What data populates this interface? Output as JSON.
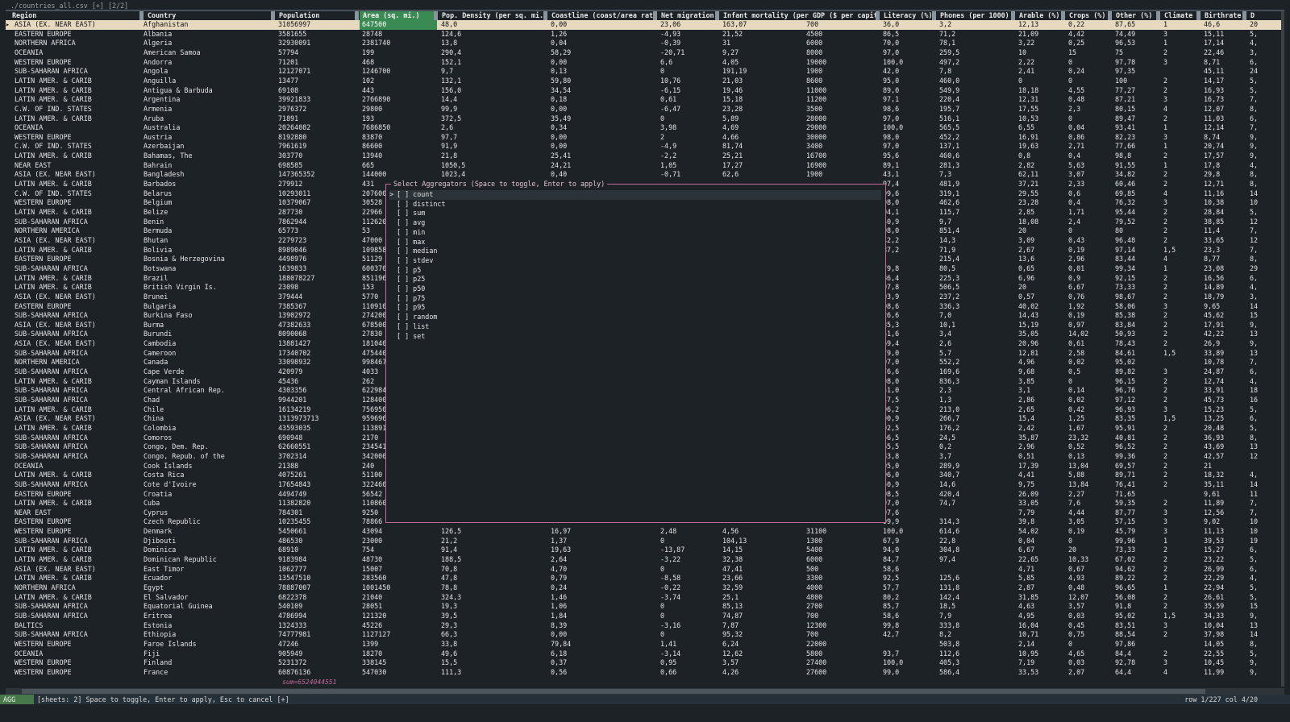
{
  "window": {
    "title": "./countries_all.csv [+] [2/2]"
  },
  "columns": [
    {
      "label": "Region"
    },
    {
      "label": "Country"
    },
    {
      "label": "Population"
    },
    {
      "label": "Area (sq. mi.)",
      "active": true
    },
    {
      "label": "Pop. Density (per sq. mi.)"
    },
    {
      "label": "Coastline (coast/area ratio)"
    },
    {
      "label": "Net migration"
    },
    {
      "label": "Infant mortality (per GDP ($ per capita)"
    },
    {
      "label": "Literacy (%)"
    },
    {
      "label": "Phones (per 1000)"
    },
    {
      "label": "Arable (%)"
    },
    {
      "label": "Crops (%)"
    },
    {
      "label": "Other (%)"
    },
    {
      "label": "Climate"
    },
    {
      "label": "Birthrate"
    },
    {
      "label": "D"
    }
  ],
  "rows": [
    [
      "ASIA (EX. NEAR EAST)",
      "Afghanistan",
      "31056997",
      "647500",
      "48,0",
      "0,00",
      "23,06",
      "163,07",
      "700",
      "36,0",
      "3,2",
      "12,13",
      "0,22",
      "87,65",
      "1",
      "46,6",
      "20"
    ],
    [
      "EASTERN EUROPE",
      "Albania",
      "3581655",
      "28748",
      "124,6",
      "1,26",
      "-4,93",
      "21,52",
      "4500",
      "86,5",
      "71,2",
      "21,09",
      "4,42",
      "74,49",
      "3",
      "15,11",
      "5,"
    ],
    [
      "NORTHERN AFRICA",
      "Algeria",
      "32930091",
      "2381740",
      "13,8",
      "0,04",
      "-0,39",
      "31",
      "6000",
      "70,0",
      "78,1",
      "3,22",
      "0,25",
      "96,53",
      "1",
      "17,14",
      "4,"
    ],
    [
      "OCEANIA",
      "American Samoa",
      "57794",
      "199",
      "290,4",
      "58,29",
      "-20,71",
      "9,27",
      "8000",
      "97,0",
      "259,5",
      "10",
      "15",
      "75",
      "2",
      "22,46",
      "3,"
    ],
    [
      "WESTERN EUROPE",
      "Andorra",
      "71201",
      "468",
      "152,1",
      "0,00",
      "6,6",
      "4,05",
      "19000",
      "100,0",
      "497,2",
      "2,22",
      "0",
      "97,78",
      "3",
      "8,71",
      "6,"
    ],
    [
      "SUB-SAHARAN AFRICA",
      "Angola",
      "12127071",
      "1246700",
      "9,7",
      "0,13",
      "0",
      "191,19",
      "1900",
      "42,0",
      "7,8",
      "2,41",
      "0,24",
      "97,35",
      "",
      "45,11",
      "24"
    ],
    [
      "LATIN AMER. & CARIB",
      "Anguilla",
      "13477",
      "102",
      "132,1",
      "59,80",
      "10,76",
      "21,03",
      "8600",
      "95,0",
      "460,0",
      "0",
      "0",
      "100",
      "2",
      "14,17",
      "5,"
    ],
    [
      "LATIN AMER. & CARIB",
      "Antigua & Barbuda",
      "69108",
      "443",
      "156,0",
      "34,54",
      "-6,15",
      "19,46",
      "11000",
      "89,0",
      "549,9",
      "18,18",
      "4,55",
      "77,27",
      "2",
      "16,93",
      "5,"
    ],
    [
      "LATIN AMER. & CARIB",
      "Argentina",
      "39921833",
      "2766890",
      "14,4",
      "0,18",
      "0,61",
      "15,18",
      "11200",
      "97,1",
      "220,4",
      "12,31",
      "0,48",
      "87,21",
      "3",
      "16,73",
      "7,"
    ],
    [
      "C.W. OF IND. STATES",
      "Armenia",
      "2976372",
      "29800",
      "99,9",
      "0,00",
      "-6,47",
      "23,28",
      "3500",
      "98,6",
      "195,7",
      "17,55",
      "2,3",
      "80,15",
      "4",
      "12,07",
      "8,"
    ],
    [
      "LATIN AMER. & CARIB",
      "Aruba",
      "71891",
      "193",
      "372,5",
      "35,49",
      "0",
      "5,89",
      "28000",
      "97,0",
      "516,1",
      "10,53",
      "0",
      "89,47",
      "2",
      "11,03",
      "6,"
    ],
    [
      "OCEANIA",
      "Australia",
      "20264082",
      "7686850",
      "2,6",
      "0,34",
      "3,98",
      "4,69",
      "29000",
      "100,0",
      "565,5",
      "6,55",
      "0,04",
      "93,41",
      "1",
      "12,14",
      "7,"
    ],
    [
      "WESTERN EUROPE",
      "Austria",
      "8192880",
      "83870",
      "97,7",
      "0,00",
      "2",
      "4,66",
      "30000",
      "98,0",
      "452,2",
      "16,91",
      "0,86",
      "82,23",
      "3",
      "8,74",
      "9,"
    ],
    [
      "C.W. OF IND. STATES",
      "Azerbaijan",
      "7961619",
      "86600",
      "91,9",
      "0,00",
      "-4,9",
      "81,74",
      "3400",
      "97,0",
      "137,1",
      "19,63",
      "2,71",
      "77,66",
      "1",
      "20,74",
      "9,"
    ],
    [
      "LATIN AMER. & CARIB",
      "Bahamas, The",
      "303770",
      "13940",
      "21,8",
      "25,41",
      "-2,2",
      "25,21",
      "16700",
      "95,6",
      "460,6",
      "0,8",
      "0,4",
      "98,8",
      "2",
      "17,57",
      "9,"
    ],
    [
      "NEAR EAST",
      "Bahrain",
      "698585",
      "665",
      "1050,5",
      "24,21",
      "1,05",
      "17,27",
      "16900",
      "89,1",
      "281,3",
      "2,82",
      "5,63",
      "91,55",
      "1",
      "17,8",
      "4,"
    ],
    [
      "ASIA (EX. NEAR EAST)",
      "Bangladesh",
      "147365352",
      "144000",
      "1023,4",
      "0,40",
      "-0,71",
      "62,6",
      "1900",
      "43,1",
      "7,3",
      "62,11",
      "3,07",
      "34,82",
      "2",
      "29,8",
      "8,"
    ],
    [
      "LATIN AMER. & CARIB",
      "Barbados",
      "279912",
      "431",
      "",
      "",
      "",
      "",
      "",
      "97,4",
      "481,9",
      "37,21",
      "2,33",
      "60,46",
      "2",
      "12,71",
      "8,"
    ],
    [
      "C.W. OF IND. STATES",
      "Belarus",
      "10293011",
      "207600",
      "",
      "",
      "",
      "",
      "",
      "99,6",
      "319,1",
      "29,55",
      "0,6",
      "69,85",
      "4",
      "11,16",
      "14"
    ],
    [
      "WESTERN EUROPE",
      "Belgium",
      "10379067",
      "30528",
      "",
      "",
      "",
      "",
      "",
      "98,0",
      "462,6",
      "23,28",
      "0,4",
      "76,32",
      "3",
      "10,38",
      "10"
    ],
    [
      "LATIN AMER. & CARIB",
      "Belize",
      "287730",
      "22966",
      "",
      "",
      "",
      "",
      "",
      "94,1",
      "115,7",
      "2,85",
      "1,71",
      "95,44",
      "2",
      "28,84",
      "5,"
    ],
    [
      "SUB-SAHARAN AFRICA",
      "Benin",
      "7862944",
      "112620",
      "",
      "",
      "",
      "",
      "",
      "40,9",
      "9,7",
      "18,08",
      "2,4",
      "79,52",
      "2",
      "38,85",
      "12"
    ],
    [
      "NORTHERN AMERICA",
      "Bermuda",
      "65773",
      "53",
      "",
      "",
      "",
      "",
      "",
      "98,0",
      "851,4",
      "20",
      "0",
      "80",
      "2",
      "11,4",
      "7,"
    ],
    [
      "ASIA (EX. NEAR EAST)",
      "Bhutan",
      "2279723",
      "47000",
      "",
      "",
      "",
      "",
      "",
      "42,2",
      "14,3",
      "3,09",
      "0,43",
      "96,48",
      "2",
      "33,65",
      "12"
    ],
    [
      "LATIN AMER. & CARIB",
      "Bolivia",
      "8989046",
      "109858",
      "",
      "",
      "",
      "",
      "",
      "87,2",
      "71,9",
      "2,67",
      "0,19",
      "97,14",
      "1,5",
      "23,3",
      "7,"
    ],
    [
      "EASTERN EUROPE",
      "Bosnia & Herzegovina",
      "4498976",
      "51129",
      "",
      "",
      "",
      "",
      "",
      "",
      "215,4",
      "13,6",
      "2,96",
      "83,44",
      "4",
      "8,77",
      "8,"
    ],
    [
      "SUB-SAHARAN AFRICA",
      "Botswana",
      "1639833",
      "600370",
      "",
      "",
      "",
      "",
      "",
      "79,8",
      "80,5",
      "0,65",
      "0,01",
      "99,34",
      "1",
      "23,08",
      "29"
    ],
    [
      "LATIN AMER. & CARIB",
      "Brazil",
      "188078227",
      "851196",
      "",
      "",
      "",
      "",
      "",
      "86,4",
      "225,3",
      "6,96",
      "0,9",
      "92,15",
      "2",
      "16,56",
      "6,"
    ],
    [
      "LATIN AMER. & CARIB",
      "British Virgin Is.",
      "23098",
      "153",
      "",
      "",
      "",
      "",
      "",
      "97,8",
      "506,5",
      "20",
      "6,67",
      "73,33",
      "2",
      "14,89",
      "4,"
    ],
    [
      "ASIA (EX. NEAR EAST)",
      "Brunei",
      "379444",
      "5770",
      "",
      "",
      "",
      "",
      "",
      "93,9",
      "237,2",
      "0,57",
      "0,76",
      "98,67",
      "2",
      "18,79",
      "3,"
    ],
    [
      "EASTERN EUROPE",
      "Bulgaria",
      "7385367",
      "110910",
      "",
      "",
      "",
      "",
      "",
      "98,6",
      "336,3",
      "40,02",
      "1,92",
      "58,06",
      "3",
      "9,65",
      "14"
    ],
    [
      "SUB-SAHARAN AFRICA",
      "Burkina Faso",
      "13902972",
      "274200",
      "",
      "",
      "",
      "",
      "",
      "26,6",
      "7,0",
      "14,43",
      "0,19",
      "85,38",
      "2",
      "45,62",
      "15"
    ],
    [
      "ASIA (EX. NEAR EAST)",
      "Burma",
      "47382633",
      "678500",
      "",
      "",
      "",
      "",
      "",
      "85,3",
      "10,1",
      "15,19",
      "0,97",
      "83,84",
      "2",
      "17,91",
      "9,"
    ],
    [
      "SUB-SAHARAN AFRICA",
      "Burundi",
      "8090068",
      "27830",
      "",
      "",
      "",
      "",
      "",
      "51,6",
      "3,4",
      "35,05",
      "14,02",
      "50,93",
      "2",
      "42,22",
      "13"
    ],
    [
      "ASIA (EX. NEAR EAST)",
      "Cambodia",
      "13881427",
      "181040",
      "",
      "",
      "",
      "",
      "",
      "69,4",
      "2,6",
      "20,96",
      "0,61",
      "78,43",
      "2",
      "26,9",
      "9,"
    ],
    [
      "SUB-SAHARAN AFRICA",
      "Cameroon",
      "17340702",
      "475440",
      "",
      "",
      "",
      "",
      "",
      "79,0",
      "5,7",
      "12,81",
      "2,58",
      "84,61",
      "1,5",
      "33,89",
      "13"
    ],
    [
      "NORTHERN AMERICA",
      "Canada",
      "33098932",
      "998467",
      "",
      "",
      "",
      "",
      "",
      "97,0",
      "552,2",
      "4,96",
      "0,02",
      "95,02",
      "",
      "10,78",
      "7,"
    ],
    [
      "SUB-SAHARAN AFRICA",
      "Cape Verde",
      "420979",
      "4033",
      "",
      "",
      "",
      "",
      "",
      "76,6",
      "169,6",
      "9,68",
      "0,5",
      "89,82",
      "3",
      "24,87",
      "6,"
    ],
    [
      "LATIN AMER. & CARIB",
      "Cayman Islands",
      "45436",
      "262",
      "",
      "",
      "",
      "",
      "",
      "98,0",
      "836,3",
      "3,85",
      "0",
      "96,15",
      "2",
      "12,74",
      "4,"
    ],
    [
      "SUB-SAHARAN AFRICA",
      "Central African Rep.",
      "4303356",
      "622984",
      "",
      "",
      "",
      "",
      "",
      "51,0",
      "2,3",
      "3,1",
      "0,14",
      "96,76",
      "2",
      "33,91",
      "18"
    ],
    [
      "SUB-SAHARAN AFRICA",
      "Chad",
      "9944201",
      "128400",
      "",
      "",
      "",
      "",
      "",
      "47,5",
      "1,3",
      "2,86",
      "0,02",
      "97,12",
      "2",
      "45,73",
      "16"
    ],
    [
      "LATIN AMER. & CARIB",
      "Chile",
      "16134219",
      "756950",
      "",
      "",
      "",
      "",
      "",
      "96,2",
      "213,0",
      "2,65",
      "0,42",
      "96,93",
      "3",
      "15,23",
      "5,"
    ],
    [
      "ASIA (EX. NEAR EAST)",
      "China",
      "1313973713",
      "959696",
      "",
      "",
      "",
      "",
      "",
      "90,9",
      "266,7",
      "15,4",
      "1,25",
      "83,35",
      "1,5",
      "13,25",
      "6,"
    ],
    [
      "LATIN AMER. & CARIB",
      "Colombia",
      "43593035",
      "113891",
      "",
      "",
      "",
      "",
      "",
      "92,5",
      "176,2",
      "2,42",
      "1,67",
      "95,91",
      "2",
      "20,48",
      "5,"
    ],
    [
      "SUB-SAHARAN AFRICA",
      "Comoros",
      "690948",
      "2170",
      "",
      "",
      "",
      "",
      "",
      "56,5",
      "24,5",
      "35,87",
      "23,32",
      "40,81",
      "2",
      "36,93",
      "8,"
    ],
    [
      "SUB-SAHARAN AFRICA",
      "Congo, Dem. Rep.",
      "62660551",
      "234541",
      "",
      "",
      "",
      "",
      "",
      "65,5",
      "0,2",
      "2,96",
      "0,52",
      "96,52",
      "2",
      "43,69",
      "13"
    ],
    [
      "SUB-SAHARAN AFRICA",
      "Congo, Repub. of the",
      "3702314",
      "342000",
      "",
      "",
      "",
      "",
      "",
      "83,8",
      "3,7",
      "0,51",
      "0,13",
      "99,36",
      "2",
      "42,57",
      "12"
    ],
    [
      "OCEANIA",
      "Cook Islands",
      "21388",
      "240",
      "",
      "",
      "",
      "",
      "",
      "95,0",
      "289,9",
      "17,39",
      "13,04",
      "69,57",
      "2",
      "21",
      ""
    ],
    [
      "LATIN AMER. & CARIB",
      "Costa Rica",
      "4075261",
      "51100",
      "",
      "",
      "",
      "",
      "",
      "96,0",
      "340,7",
      "4,41",
      "5,88",
      "89,71",
      "2",
      "18,32",
      "4,"
    ],
    [
      "SUB-SAHARAN AFRICA",
      "Cote d'Ivoire",
      "17654843",
      "322460",
      "",
      "",
      "",
      "",
      "",
      "50,9",
      "14,6",
      "9,75",
      "13,84",
      "76,41",
      "2",
      "35,11",
      "14"
    ],
    [
      "EASTERN EUROPE",
      "Croatia",
      "4494749",
      "56542",
      "",
      "",
      "",
      "",
      "",
      "98,5",
      "420,4",
      "26,09",
      "2,27",
      "71,65",
      "",
      "9,61",
      "11"
    ],
    [
      "LATIN AMER. & CARIB",
      "Cuba",
      "11382820",
      "110860",
      "",
      "",
      "",
      "",
      "",
      "97,0",
      "74,7",
      "33,05",
      "7,6",
      "59,35",
      "2",
      "11,89",
      "7,"
    ],
    [
      "NEAR EAST",
      "Cyprus",
      "784301",
      "9250",
      "",
      "",
      "",
      "",
      "",
      "97,6",
      "",
      "7,79",
      "4,44",
      "87,77",
      "3",
      "12,56",
      "7,"
    ],
    [
      "EASTERN EUROPE",
      "Czech Republic",
      "10235455",
      "78866",
      "",
      "",
      "",
      "",
      "",
      "99,9",
      "314,3",
      "39,8",
      "3,05",
      "57,15",
      "3",
      "9,02",
      "10"
    ],
    [
      "WESTERN EUROPE",
      "Denmark",
      "5450661",
      "43094",
      "126,5",
      "16,97",
      "2,48",
      "4,56",
      "31100",
      "100,0",
      "614,6",
      "54,02",
      "0,19",
      "45,79",
      "3",
      "11,13",
      "10"
    ],
    [
      "SUB-SAHARAN AFRICA",
      "Djibouti",
      "486530",
      "23000",
      "21,2",
      "1,37",
      "0",
      "104,13",
      "1300",
      "67,9",
      "22,8",
      "0,04",
      "0",
      "99,96",
      "1",
      "39,53",
      "19"
    ],
    [
      "LATIN AMER. & CARIB",
      "Dominica",
      "68910",
      "754",
      "91,4",
      "19,63",
      "-13,87",
      "14,15",
      "5400",
      "94,0",
      "304,8",
      "6,67",
      "20",
      "73,33",
      "2",
      "15,27",
      "6,"
    ],
    [
      "LATIN AMER. & CARIB",
      "Dominican Republic",
      "9183984",
      "48730",
      "188,5",
      "2,64",
      "-3,22",
      "32,38",
      "6000",
      "84,7",
      "97,4",
      "22,65",
      "10,33",
      "67,02",
      "2",
      "23,22",
      "5,"
    ],
    [
      "ASIA (EX. NEAR EAST)",
      "East Timor",
      "1062777",
      "15007",
      "70,8",
      "4,70",
      "0",
      "47,41",
      "500",
      "58,6",
      "",
      "4,71",
      "0,67",
      "94,62",
      "2",
      "26,99",
      "6,"
    ],
    [
      "LATIN AMER. & CARIB",
      "Ecuador",
      "13547510",
      "283560",
      "47,8",
      "0,79",
      "-8,58",
      "23,66",
      "3300",
      "92,5",
      "125,6",
      "5,85",
      "4,93",
      "89,22",
      "2",
      "22,29",
      "4,"
    ],
    [
      "NORTHERN AFRICA",
      "Egypt",
      "78887007",
      "1001450",
      "78,8",
      "0,24",
      "-0,22",
      "32,59",
      "4000",
      "57,7",
      "131,8",
      "2,87",
      "0,48",
      "96,65",
      "1",
      "22,94",
      "5,"
    ],
    [
      "LATIN AMER. & CARIB",
      "El Salvador",
      "6822378",
      "21040",
      "324,3",
      "1,46",
      "-3,74",
      "25,1",
      "4800",
      "80,2",
      "142,4",
      "31,85",
      "12,07",
      "56,08",
      "2",
      "26,61",
      "5,"
    ],
    [
      "SUB-SAHARAN AFRICA",
      "Equatorial Guinea",
      "540109",
      "28051",
      "19,3",
      "1,06",
      "0",
      "85,13",
      "2700",
      "85,7",
      "18,5",
      "4,63",
      "3,57",
      "91,8",
      "2",
      "35,59",
      "15"
    ],
    [
      "SUB-SAHARAN AFRICA",
      "Eritrea",
      "4786994",
      "121320",
      "39,5",
      "1,84",
      "0",
      "74,87",
      "700",
      "58,6",
      "7,9",
      "4,95",
      "0,03",
      "95,02",
      "1,5",
      "34,33",
      "9,"
    ],
    [
      "BALTICS",
      "Estonia",
      "1324333",
      "45226",
      "29,3",
      "8,39",
      "-3,16",
      "7,87",
      "12300",
      "99,8",
      "333,8",
      "16,04",
      "0,45",
      "83,51",
      "3",
      "10,04",
      "13"
    ],
    [
      "SUB-SAHARAN AFRICA",
      "Ethiopia",
      "74777981",
      "1127127",
      "66,3",
      "0,00",
      "0",
      "95,32",
      "700",
      "42,7",
      "8,2",
      "10,71",
      "0,75",
      "88,54",
      "2",
      "37,98",
      "14"
    ],
    [
      "WESTERN EUROPE",
      "Faroe Islands",
      "47246",
      "1399",
      "33,8",
      "79,84",
      "1,41",
      "6,24",
      "22000",
      "",
      "503,8",
      "2,14",
      "0",
      "97,86",
      "",
      "14,05",
      "8,"
    ],
    [
      "OCEANIA",
      "Fiji",
      "905949",
      "18270",
      "49,6",
      "6,18",
      "-3,14",
      "12,62",
      "5800",
      "93,7",
      "112,6",
      "10,95",
      "4,65",
      "84,4",
      "2",
      "22,55",
      "5,"
    ],
    [
      "WESTERN EUROPE",
      "Finland",
      "5231372",
      "338145",
      "15,5",
      "0,37",
      "0,95",
      "3,57",
      "27400",
      "100,0",
      "405,3",
      "7,19",
      "0,03",
      "92,78",
      "3",
      "10,45",
      "9,"
    ],
    [
      "WESTERN EUROPE",
      "France",
      "60876136",
      "547030",
      "111,3",
      "0,56",
      "0,66",
      "4,26",
      "27600",
      "99,0",
      "586,4",
      "33,53",
      "2,07",
      "64,4",
      "4",
      "11,99",
      "9,"
    ]
  ],
  "modal": {
    "title": "Select Aggregators (Space to toggle, Enter to apply)",
    "options": [
      "[ ] count",
      "[ ] distinct",
      "[ ] sum",
      "[ ] avg",
      "[ ] min",
      "[ ] max",
      "[ ] median",
      "[ ] stdev",
      "[ ] p5",
      "[ ] p25",
      "[ ] p50",
      "[ ] p75",
      "[ ] p95",
      "[ ] random",
      "[ ] list",
      "[ ] set"
    ],
    "cursor": ">"
  },
  "footer": {
    "sum_label": "sum=6524044551",
    "mode": "AGG",
    "command": "[sheets: 2] Space to toggle, Enter to apply, Esc to cancel [+]",
    "position": "row 1/227 col 4/20"
  },
  "colors": {
    "accent": "#3a8a54",
    "modal_border": "#c4689a",
    "cursor_row": "#e6d9bf",
    "sum_text": "#c4689a"
  }
}
